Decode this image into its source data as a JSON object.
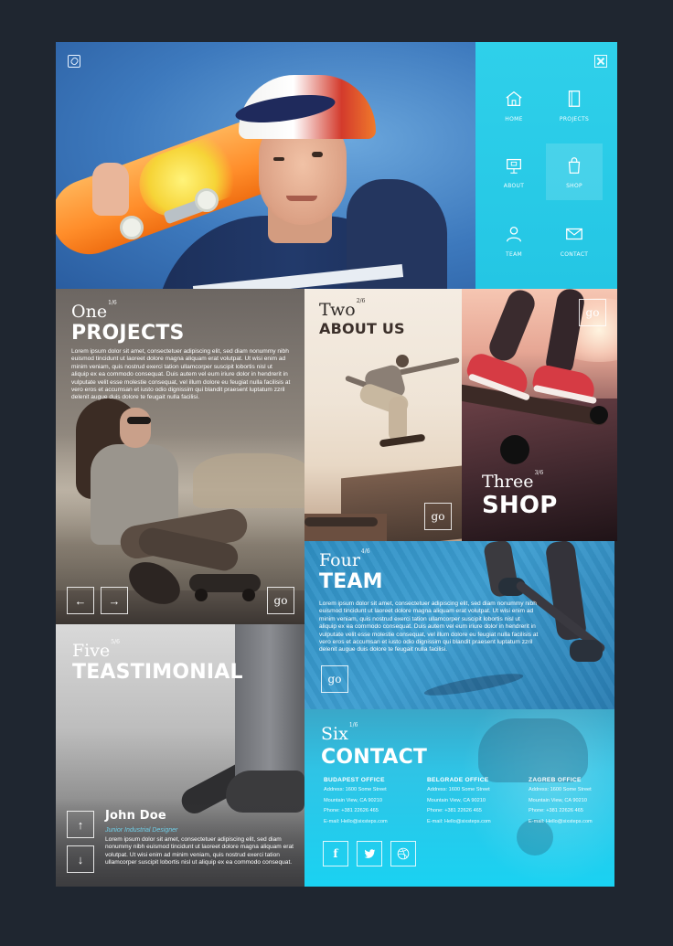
{
  "nav": {
    "items": [
      {
        "label": "HOME",
        "icon": "home-icon"
      },
      {
        "label": "PROJECTS",
        "icon": "projects-icon"
      },
      {
        "label": "ABOUT",
        "icon": "about-icon"
      },
      {
        "label": "SHOP",
        "icon": "shopping-bag-icon"
      },
      {
        "label": "TEAM",
        "icon": "team-icon"
      },
      {
        "label": "CONTACT",
        "icon": "mail-icon"
      }
    ]
  },
  "projects": {
    "num": "One",
    "fraction": "1/6",
    "title": "PROJECTS",
    "text": "Lorem ipsum dolor sit amet, consectetuer adipiscing elit, sed diam nonummy nibh euismod tincidunt ut laoreet dolore magna aliquam erat volutpat. Ut wisi enim ad minim veniam, quis nostrud exerci tation ullamcorper suscipit lobortis nisl ut aliquip ex ea commodo consequat. Duis autem vel eum iriure dolor in hendrerit in vulputate velit esse molestie consequat, vel illum dolore eu feugiat nulla facilisis at vero eros et accumsan et iusto odio dignissim qui blandit praesent luptatum zzril delenit augue duis dolore te feugait nulla facilisi.",
    "prev": "←",
    "next": "→",
    "go": "go"
  },
  "about": {
    "num": "Two",
    "fraction": "2/6",
    "title": "ABOUT US",
    "go": "go"
  },
  "shop": {
    "num": "Three",
    "fraction": "3/6",
    "title": "SHOP",
    "go": "go"
  },
  "team": {
    "num": "Four",
    "fraction": "4/6",
    "title": "TEAM",
    "text": "Lorem ipsum dolor sit amet, consectetuer adipiscing elit, sed diam nonummy nibh euismod tincidunt ut laoreet dolore magna aliquam erat volutpat. Ut wisi enim ad minim veniam, quis nostrud exerci tation ullamcorper suscipit lobortis nisl ut aliquip ex ea commodo consequat. Duis autem vel eum iriure dolor in hendrerit in vulputate velit esse molestie consequat, vel illum dolore eu feugiat nulla facilisis at vero eros et accumsan et iusto odio dignissim qui blandit praesent luptatum zzril delenit augue duis dolore te feugait nulla facilisi.",
    "go": "go"
  },
  "testimonial": {
    "num": "Five",
    "fraction": "5/6",
    "title": "TEASTIMONIAL",
    "name": "John Doe",
    "role": "Junior Industrial Designer",
    "text": "Lorem ipsum dolor sit amet, consectetuer adipiscing elit, sed diam nonummy nibh euismod tincidunt ut laoreet dolore magna aliquam erat volutpat. Ut wisi enim ad minim veniam, quis nostrud exerci tation ullamcorper suscipit lobortis nisl ut aliquip ex ea commodo consequat.",
    "up": "↑",
    "down": "↓"
  },
  "contact": {
    "num": "Six",
    "fraction": "1/6",
    "title": "CONTACT",
    "offices": [
      {
        "name": "BUDAPEST OFFICE",
        "address": "Address: 1600 Some Street",
        "city": "Mountain View, CA 90210",
        "phone": "Phone: +381 22626 465",
        "email": "E-mail: Hello@sixsteps.com"
      },
      {
        "name": "BELGRADE OFFICE",
        "address": "Address: 1600 Some Street",
        "city": "Mountain View, CA 90210",
        "phone": "Phone: +381 22626 465",
        "email": "E-mail: Hello@sixsteps.com"
      },
      {
        "name": "ZAGREB OFFICE",
        "address": "Address: 1600 Some Street",
        "city": "Mountain View, CA 90210",
        "phone": "Phone: +381 22626 465",
        "email": "E-mail: Hello@sixsteps.com"
      }
    ],
    "social": [
      {
        "label": "f",
        "icon": "facebook-icon"
      },
      {
        "label": "t",
        "icon": "twitter-icon"
      },
      {
        "label": "",
        "icon": "dribbble-icon"
      }
    ]
  }
}
